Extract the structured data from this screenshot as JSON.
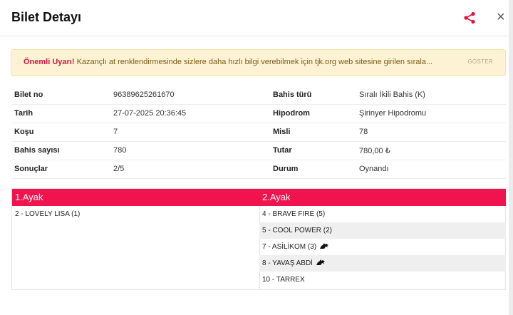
{
  "modal": {
    "title": "Bilet Detayı",
    "share_icon": "share-icon",
    "close_label": "×"
  },
  "alert": {
    "strong": "Önemli Uyarı!",
    "text": " Kazançlı at renklendirmesinde sizlere daha hızlı bilgi verebilmek için tjk.org web sitesine girilen sırala...",
    "button": "GÖSTER"
  },
  "info": {
    "rows": [
      {
        "k1": "Bilet no",
        "v1": "96389625261670",
        "k2": "Bahis türü",
        "v2": "Sıralı İkili Bahis (K)"
      },
      {
        "k1": "Tarih",
        "v1": "27-07-2025 20:36:45",
        "k2": "Hipodrom",
        "v2": "Şirinyer Hipodromu"
      },
      {
        "k1": "Koşu",
        "v1": "7",
        "k2": "Misli",
        "v2": "78"
      },
      {
        "k1": "Bahis sayısı",
        "v1": "780",
        "k2": "Tutar",
        "v2": "780,00 ₺"
      },
      {
        "k1": "Sonuçlar",
        "v1": "2/5",
        "k2": "Durum",
        "v2": "Oynandı"
      }
    ]
  },
  "legs": [
    {
      "title": "1.Ayak",
      "horses": [
        {
          "label": "2 - LOVELY LISA (1)",
          "icon": false
        }
      ]
    },
    {
      "title": "2.Ayak",
      "horses": [
        {
          "label": "4 - BRAVE FIRE (5)",
          "icon": false
        },
        {
          "label": "5 - COOL POWER (2)",
          "icon": false
        },
        {
          "label": "7 - ASİLİKOM (3)",
          "icon": true
        },
        {
          "label": "8 - YAVAŞ ABDİ",
          "icon": true
        },
        {
          "label": "10 - TARREX",
          "icon": false
        }
      ]
    }
  ],
  "colors": {
    "accent": "#f0134d",
    "alert_bg": "#fdf3d4"
  }
}
